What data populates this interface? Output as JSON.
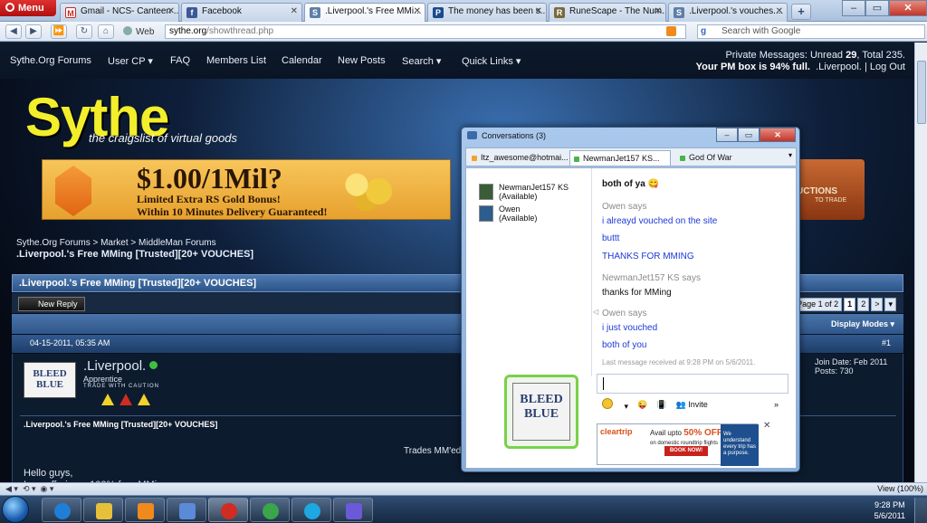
{
  "browser": {
    "menu_label": "Menu",
    "tabs": [
      {
        "label": "Gmail - NCS- Canteen ...",
        "icon": "gmail-icon",
        "color": "#c5291d",
        "active": false
      },
      {
        "label": "Facebook",
        "icon": "facebook-icon",
        "color": "#3b5998",
        "active": false
      },
      {
        "label": ".Liverpool.'s Free MMi...",
        "icon": "sythe-icon",
        "color": "#5d7fa8",
        "active": true
      },
      {
        "label": "The money has been s...",
        "icon": "p-icon",
        "color": "#1c4a8c",
        "active": false
      },
      {
        "label": "RuneScape - The Num...",
        "icon": "runescape-icon",
        "color": "#7a6a3a",
        "active": false
      },
      {
        "label": ".Liverpool.'s vouches....",
        "icon": "sythe-icon",
        "color": "#5d7fa8",
        "active": false
      }
    ],
    "new_tab": "+",
    "web_label": "Web",
    "url_domain": "sythe.org",
    "url_path": "/showthread.php",
    "search_placeholder": "Search with Google",
    "status_zoom": "View (100%)"
  },
  "site": {
    "nav": [
      "Sythe.Org Forums",
      "User CP ▾",
      "FAQ",
      "Members List",
      "Calendar",
      "New Posts",
      "Search ▾",
      "Quick Links ▾"
    ],
    "pm_line1_prefix": "Private Messages: Unread ",
    "pm_unread": "29",
    "pm_line1_mid": ", Total ",
    "pm_total": "235.",
    "pm_line2_bold": "Your PM box is 94% full.",
    "pm_user": ".Liverpool.",
    "pm_logout": "| Log Out",
    "logo": "Sythe",
    "tagline": "the craigslist of virtual goods",
    "banner": {
      "price": "$1.00/1Mil?",
      "line1": "Limited Extra RS Gold Bonus!",
      "line2": "Within 10 Minutes Delivery Guaranteed!"
    },
    "banner2": {
      "title": "UCTIONS",
      "sub": "TO TRADE"
    },
    "breadcrumb": "Sythe.Org Forums > Market > MiddleMan Forums",
    "thread_title": ".Liverpool.'s Free MMing [Trusted][20+ VOUCHES]",
    "new_reply": "New Reply",
    "pages": [
      "Page 1 of 2",
      "1",
      "2",
      ">",
      "▾"
    ],
    "display_modes": "Display Modes ▾",
    "post_date": "04-15-2011, 05:35 AM",
    "post_number": "#1",
    "post": {
      "avatar_text": "BLEED BLUE",
      "username": ".Liverpool.",
      "user_title": "Apprentice",
      "trade_caution": "TRADE WITH CAUTION",
      "join_date": "Join Date: Feb 2011",
      "posts": "Posts: 730",
      "title": ".Liverpool.'s Free MMing [Trusted][20+ VOUCHES]",
      "trades_line": "Trades MM'ed",
      "hello": "Hello guys,",
      "intro": "I am offering a 100% free MMing"
    }
  },
  "messenger": {
    "title": "Conversations (3)",
    "tabs": [
      {
        "label": "Itz_awesome@hotmai...",
        "color": "#f2a431"
      },
      {
        "label": "NewmanJet157 KS...",
        "color": "#4bb34b"
      },
      {
        "label": "God Of War",
        "color": "#4bb34b"
      }
    ],
    "contacts": [
      {
        "name": "NewmanJet157 KS",
        "status": "(Available)"
      },
      {
        "name": "Owen",
        "status": "(Available)"
      }
    ],
    "display_pic_text": "BLEED BLUE",
    "chat": [
      {
        "kind": "them",
        "text": "both of ya 😋"
      },
      {
        "kind": "says",
        "text": "Owen says"
      },
      {
        "kind": "me",
        "text": "i alreayd vouched on the site"
      },
      {
        "kind": "me",
        "text": "buttt"
      },
      {
        "kind": "me",
        "text": "THANKS FOR MMING"
      },
      {
        "kind": "says",
        "text": "NewmanJet157 KS says"
      },
      {
        "kind": "them",
        "text": "thanks for MMing"
      },
      {
        "kind": "says",
        "text": "Owen says"
      },
      {
        "kind": "me",
        "text": "i just vouched"
      },
      {
        "kind": "me",
        "text": "both of you"
      },
      {
        "kind": "last",
        "text": "Last message received at 9:28 PM on 5/6/2011."
      }
    ],
    "invite": "Invite",
    "more": "»",
    "ad": {
      "logo": "cleartrip",
      "avail": "Avail upto",
      "offer": "50% OFF",
      "sub": "on domestic roundtrip flights",
      "book": "BOOK NOW!",
      "right": "We understand every trip has a purpose."
    }
  },
  "taskbar": {
    "time": "9:28 PM",
    "date": "5/6/2011",
    "apps": [
      {
        "name": "ie",
        "color": "#1f7fd6"
      },
      {
        "name": "explorer",
        "color": "#e7c03a"
      },
      {
        "name": "media-player",
        "color": "#f08a1c"
      },
      {
        "name": "paint",
        "color": "#5a8ad8"
      },
      {
        "name": "opera",
        "color": "#d12c22"
      },
      {
        "name": "chrome",
        "color": "#3aa54a"
      },
      {
        "name": "skype",
        "color": "#1ea7e1"
      },
      {
        "name": "messenger",
        "color": "#6a5ad8"
      }
    ]
  }
}
